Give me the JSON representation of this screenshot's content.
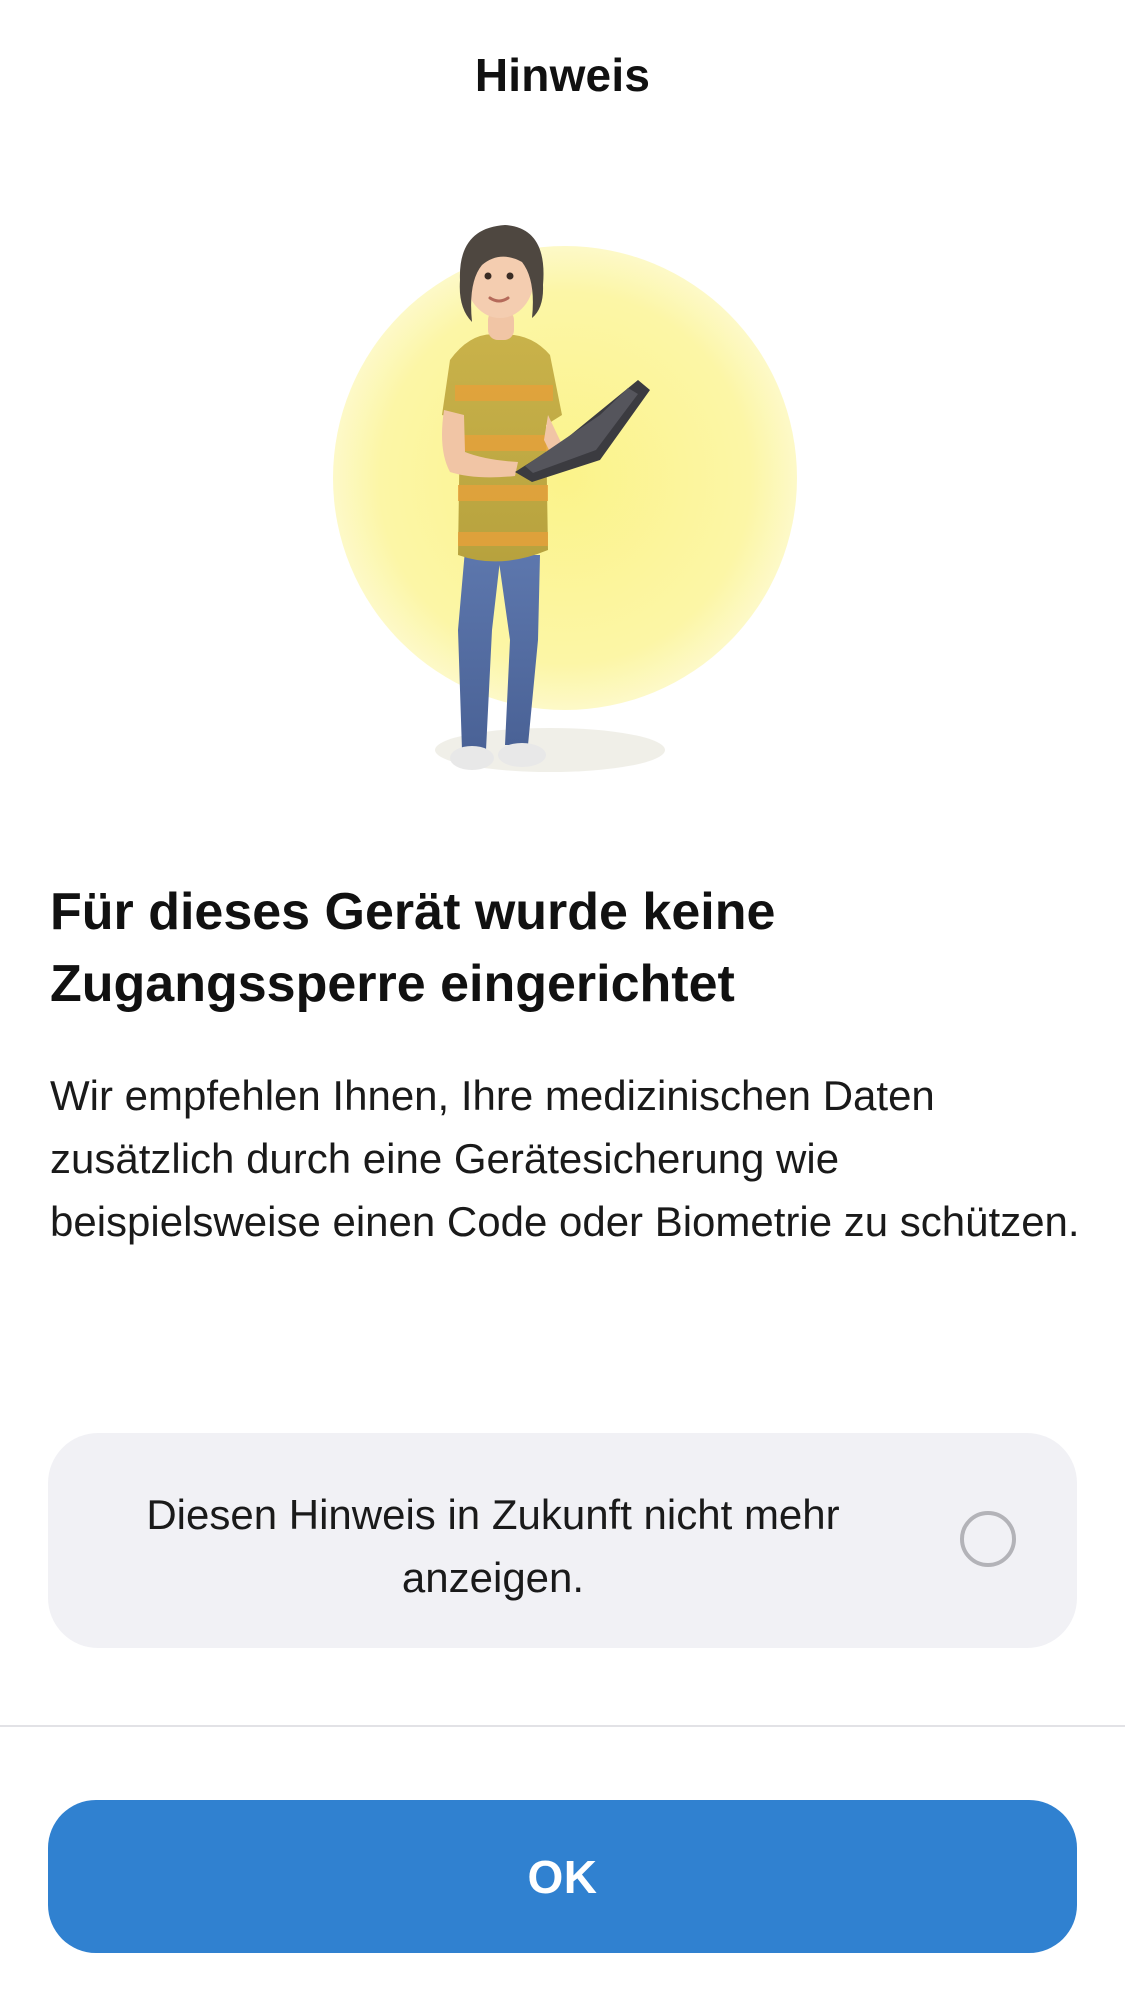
{
  "header": {
    "title": "Hinweis"
  },
  "illustration": {
    "icon": "person-with-laptop-illustration",
    "circle_color": "#fbf59a"
  },
  "content": {
    "headline": "Für dieses Gerät wurde keine Zugangssperre eingerichtet",
    "body": "Wir empfehlen Ihnen, Ihre medizinischen Daten zusätzlich durch eine Gerätesicherung wie beispielsweise einen Code oder Biometrie zu schützen."
  },
  "option": {
    "label": "Diesen Hinweis in Zukunft nicht mehr anzeigen.",
    "checked": false
  },
  "footer": {
    "ok_label": "OK"
  },
  "colors": {
    "accent": "#3081d0",
    "card_background": "#f1f1f5"
  }
}
